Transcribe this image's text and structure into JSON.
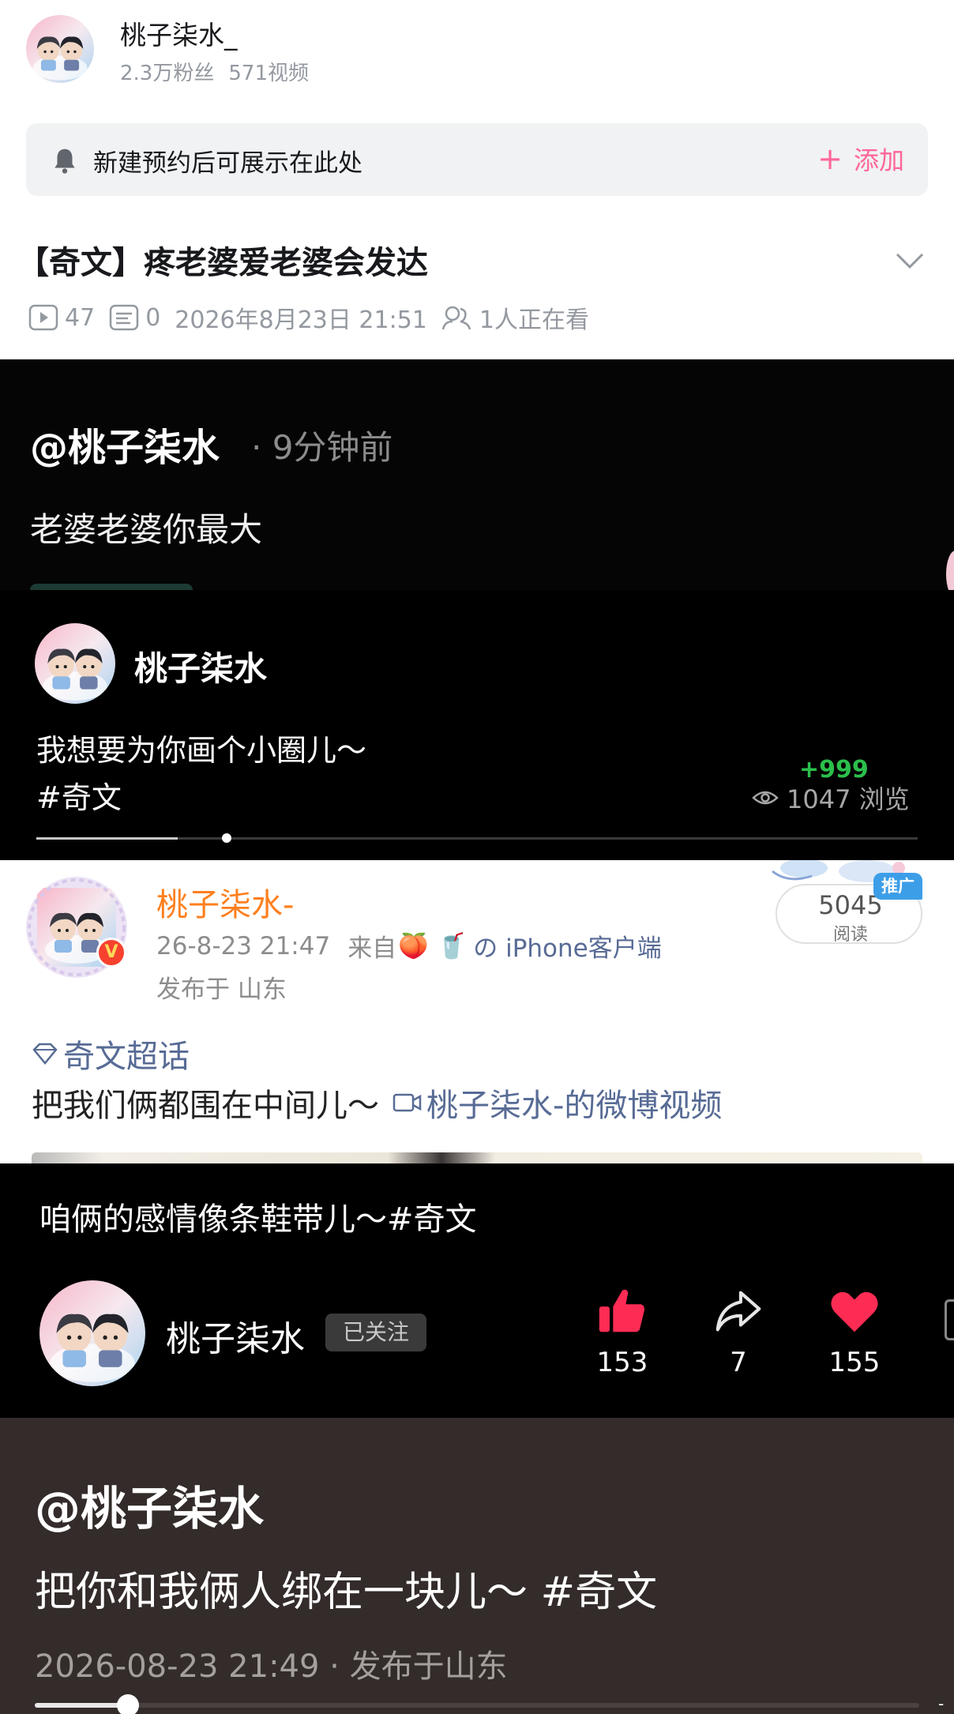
{
  "bili": {
    "channel_name": "桃子柒水_",
    "fans": "2.3万粉丝",
    "videos": "571视频",
    "reserve_text": "新建预约后可展示在此处",
    "add_label": "添加",
    "add_plus": "+",
    "video_title": "【奇文】疼老婆爱老婆会发达",
    "plays": "47",
    "danmaku": "0",
    "datetime": "2026年8月23日 21:51",
    "watching": "1人正在看",
    "accent": "#ff6699"
  },
  "post1": {
    "user": "@桃子柒水",
    "time": "· 9分钟前",
    "text": "老婆老婆你最大"
  },
  "douyin1": {
    "name": "桃子柒水",
    "text": "我想要为你画个小圈儿～",
    "tag": "#奇文",
    "plus": "+999",
    "views": "1047 浏览",
    "progress": 0.16
  },
  "weibo": {
    "name": "桃子柒水-",
    "time": "26-8-23 21:47",
    "from_prefix": "来自",
    "from_emoji": "🍑 🥤",
    "from_source": "の iPhone客户端",
    "location": "发布于 山东",
    "reads": "5045",
    "reads_label": "阅读",
    "promo": "推广",
    "verified": "V",
    "topic": "奇文超话",
    "body": "把我们俩都围在中间儿～",
    "video_link": "桃子柒水-的微博视频",
    "name_color": "#ff7f1e",
    "link_color": "#576b95"
  },
  "douyin2": {
    "caption": "咱俩的感情像条鞋带儿～#奇文",
    "name": "桃子柒水",
    "follow": "已关注",
    "likes": "153",
    "shares": "7",
    "favorites": "155"
  },
  "post2": {
    "user": "@桃子柒水",
    "text": "把你和我俩人绑在一块儿～ #奇文",
    "time": "2026-08-23 21:49 · 发布于山东",
    "progress": 0.1
  }
}
